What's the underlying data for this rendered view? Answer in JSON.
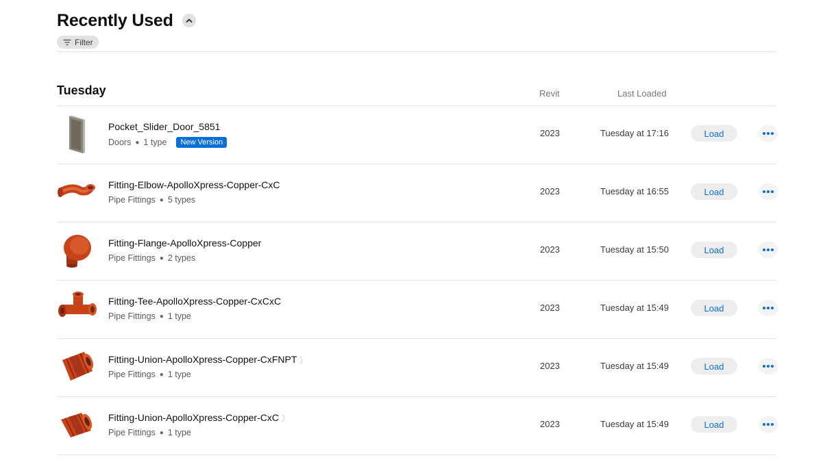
{
  "header": {
    "title": "Recently Used",
    "collapse_icon": "chevron-up-icon",
    "filter_label": "Filter",
    "filter_icon": "filter-lines-icon"
  },
  "group": {
    "title": "Tuesday",
    "col_revit": "Revit",
    "col_last_loaded": "Last Loaded"
  },
  "rows": [
    {
      "name": "Pocket_Slider_Door_5851",
      "category": "Doors",
      "types": "1 type",
      "badge": "New Version",
      "revit": "2023",
      "last_loaded": "Tuesday at 17:16",
      "load_label": "Load",
      "icon": "door-thumbnail"
    },
    {
      "name": "Fitting-Elbow-ApolloXpress-Copper-CxC",
      "category": "Pipe Fittings",
      "types": "5 types",
      "revit": "2023",
      "last_loaded": "Tuesday at 16:55",
      "load_label": "Load",
      "icon": "elbow-fitting-thumbnail"
    },
    {
      "name": "Fitting-Flange-ApolloXpress-Copper",
      "category": "Pipe Fittings",
      "types": "2 types",
      "revit": "2023",
      "last_loaded": "Tuesday at 15:50",
      "load_label": "Load",
      "icon": "flange-fitting-thumbnail"
    },
    {
      "name": "Fitting-Tee-ApolloXpress-Copper-CxCxC",
      "category": "Pipe Fittings",
      "types": "1 type",
      "revit": "2023",
      "last_loaded": "Tuesday at 15:49",
      "load_label": "Load",
      "icon": "tee-fitting-thumbnail"
    },
    {
      "name": "Fitting-Union-ApolloXpress-Copper-CxFNPT",
      "category": "Pipe Fittings",
      "types": "1 type",
      "revit": "2023",
      "last_loaded": "Tuesday at 15:49",
      "load_label": "Load",
      "icon": "union-fitting-thumbnail"
    },
    {
      "name": "Fitting-Union-ApolloXpress-Copper-CxC",
      "category": "Pipe Fittings",
      "types": "1 type",
      "revit": "2023",
      "last_loaded": "Tuesday at 15:49",
      "load_label": "Load",
      "icon": "union-fitting-thumbnail"
    }
  ],
  "colors": {
    "accent": "#0a6fd6",
    "copper": "#c8431a",
    "divider": "#e4e4e4"
  }
}
